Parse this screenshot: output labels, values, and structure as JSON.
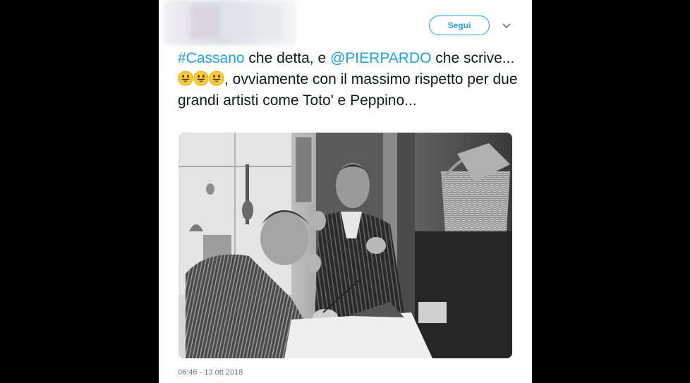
{
  "author": {
    "avatar_blurred": true
  },
  "header": {
    "follow_label": "Segui",
    "menu_icon": "chevron-down-icon"
  },
  "tweet": {
    "hashtag": "#Cassano",
    "text_1": " che detta, e ",
    "mention": "@PIERPARDO",
    "text_2": " che scrive... ",
    "emoji": [
      "grinning-face",
      "grinning-face",
      "grinning-face"
    ],
    "text_3": ", ovviamente con il massimo rispetto per due grandi artisti come Toto' e Peppino..."
  },
  "media": {
    "type": "photo",
    "description_icon": "black-and-white-photo"
  },
  "footer": {
    "timestamp": "06:46 - 13 ott 2018"
  },
  "colors": {
    "accent": "#1da1f2",
    "text": "#14171a",
    "muted": "#657786",
    "background": "#000000"
  }
}
